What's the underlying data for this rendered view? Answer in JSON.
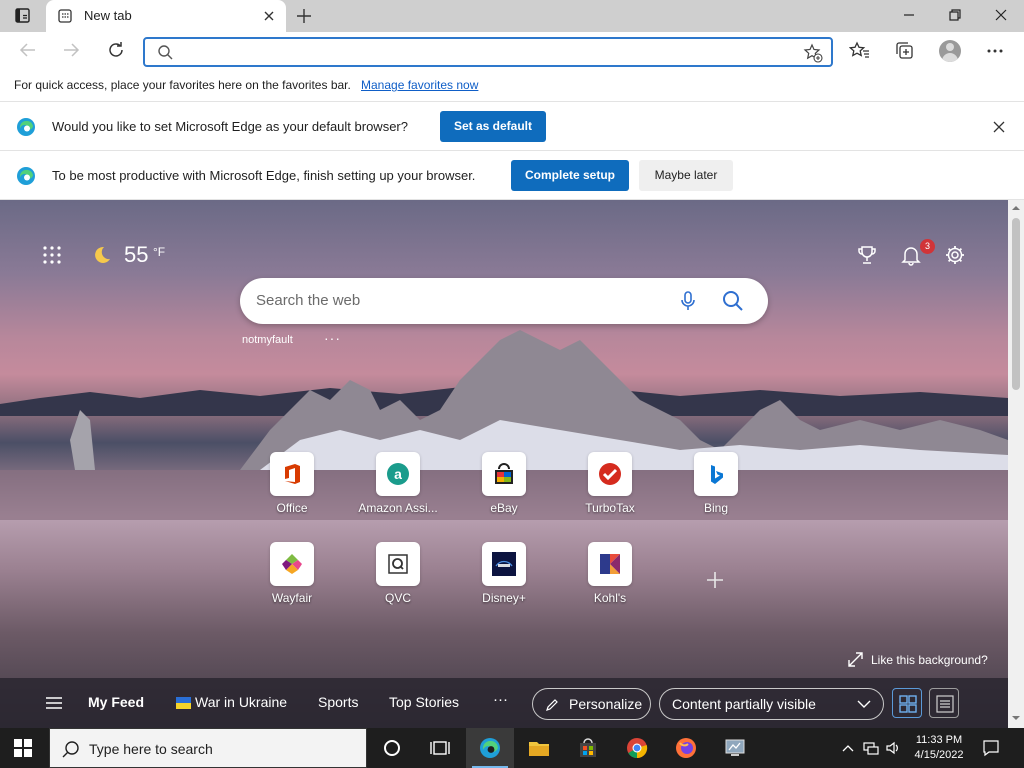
{
  "browser": {
    "tab": {
      "title": "New tab"
    },
    "favorites_bar": {
      "message": "For quick access, place your favorites here on the favorites bar.",
      "link": "Manage favorites now"
    },
    "address": {
      "placeholder": ""
    }
  },
  "infobars": [
    {
      "text": "Would you like to set Microsoft Edge as your default browser?",
      "primary": "Set as default"
    },
    {
      "text": "To be most productive with Microsoft Edge, finish setting up your browser.",
      "primary": "Complete setup",
      "secondary": "Maybe later"
    }
  ],
  "ntp": {
    "weather": {
      "temp": "55",
      "unit": "°F",
      "icon": "moon-icon"
    },
    "notifications_count": "3",
    "search": {
      "placeholder": "Search the web"
    },
    "user": "notmyfault",
    "more": "···",
    "tiles": [
      {
        "label": "Office",
        "icon": "office-icon"
      },
      {
        "label": "Amazon Assi...",
        "icon": "amazon-icon"
      },
      {
        "label": "eBay",
        "icon": "ebay-icon"
      },
      {
        "label": "TurboTax",
        "icon": "turbotax-icon"
      },
      {
        "label": "Bing",
        "icon": "bing-icon"
      },
      {
        "label": "Wayfair",
        "icon": "wayfair-icon"
      },
      {
        "label": "QVC",
        "icon": "qvc-icon"
      },
      {
        "label": "Disney+",
        "icon": "disney-icon"
      },
      {
        "label": "Kohl's",
        "icon": "kohls-icon"
      }
    ],
    "like_background": "Like this background?",
    "feed": {
      "my_feed": "My Feed",
      "items": [
        "War in Ukraine",
        "Sports",
        "Top Stories"
      ],
      "more": "···",
      "personalize": "Personalize",
      "content_visibility": "Content partially visible"
    }
  },
  "taskbar": {
    "search_placeholder": "Type here to search",
    "time": "11:33 PM",
    "date": "4/15/2022"
  },
  "colors": {
    "accent": "#0f6cbd",
    "address_border": "#2e78cc",
    "badge": "#d13438"
  }
}
